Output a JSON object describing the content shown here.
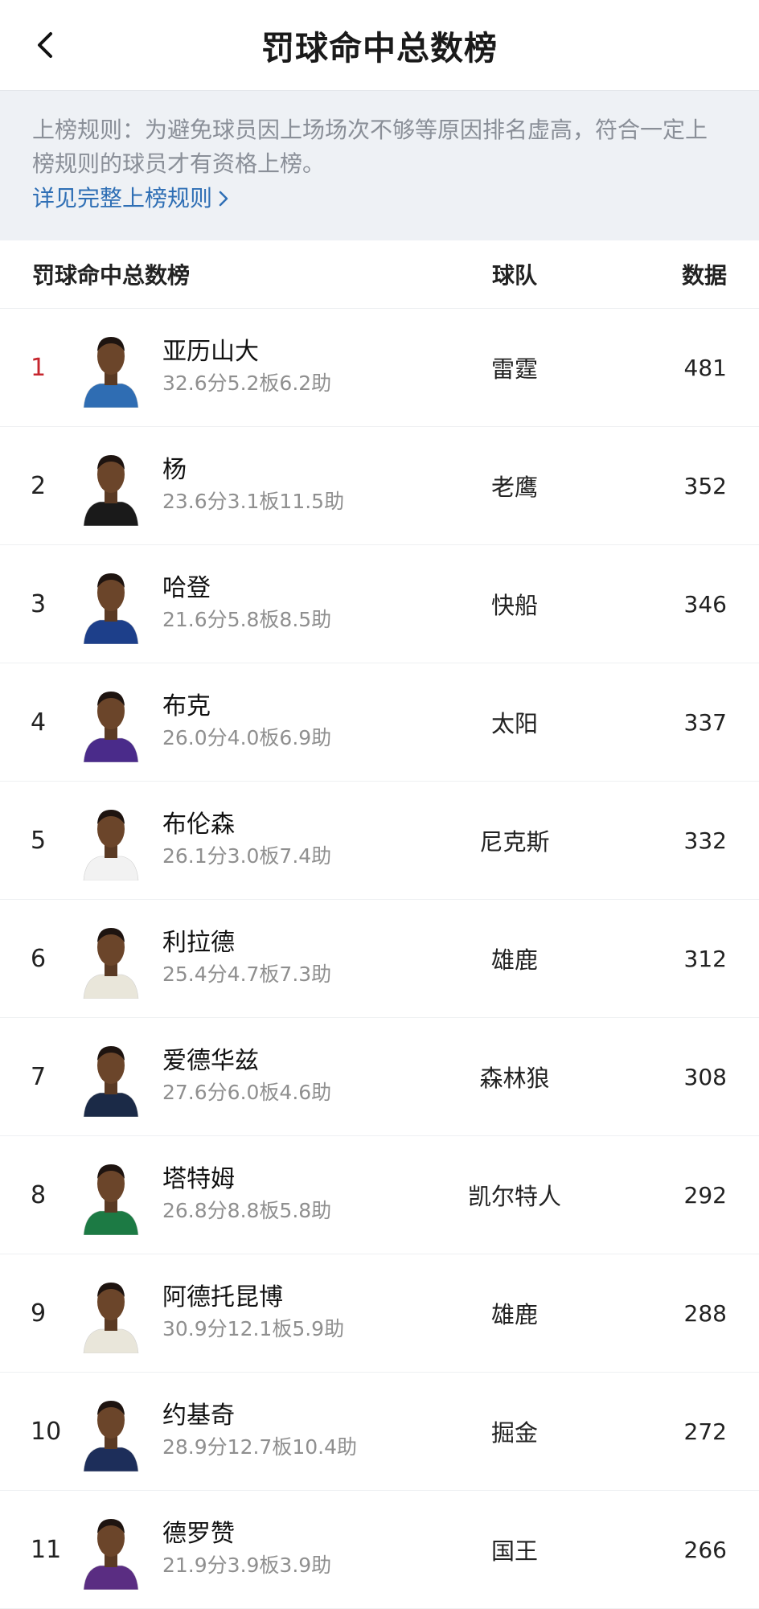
{
  "header": {
    "title": "罚球命中总数榜"
  },
  "notice": {
    "text": "上榜规则：为避免球员因上场场次不够等原因排名虚高，符合一定上榜规则的球员才有资格上榜。",
    "link": "详见完整上榜规则"
  },
  "table": {
    "columns": {
      "name": "罚球命中总数榜",
      "team": "球队",
      "stat": "数据"
    },
    "rows": [
      {
        "rank": "1",
        "name": "亚历山大",
        "line": "32.6分5.2板6.2助",
        "team": "雷霆",
        "value": "481",
        "jersey": "#2f6db3"
      },
      {
        "rank": "2",
        "name": "杨",
        "line": "23.6分3.1板11.5助",
        "team": "老鹰",
        "value": "352",
        "jersey": "#1a1a1a"
      },
      {
        "rank": "3",
        "name": "哈登",
        "line": "21.6分5.8板8.5助",
        "team": "快船",
        "value": "346",
        "jersey": "#1d3f8a"
      },
      {
        "rank": "4",
        "name": "布克",
        "line": "26.0分4.0板6.9助",
        "team": "太阳",
        "value": "337",
        "jersey": "#4a2b8a"
      },
      {
        "rank": "5",
        "name": "布伦森",
        "line": "26.1分3.0板7.4助",
        "team": "尼克斯",
        "value": "332",
        "jersey": "#f2f2f2"
      },
      {
        "rank": "6",
        "name": "利拉德",
        "line": "25.4分4.7板7.3助",
        "team": "雄鹿",
        "value": "312",
        "jersey": "#e9e6da"
      },
      {
        "rank": "7",
        "name": "爱德华兹",
        "line": "27.6分6.0板4.6助",
        "team": "森林狼",
        "value": "308",
        "jersey": "#1b2a47"
      },
      {
        "rank": "8",
        "name": "塔特姆",
        "line": "26.8分8.8板5.8助",
        "team": "凯尔特人",
        "value": "292",
        "jersey": "#1c7a44"
      },
      {
        "rank": "9",
        "name": "阿德托昆博",
        "line": "30.9分12.1板5.9助",
        "team": "雄鹿",
        "value": "288",
        "jersey": "#e9e6da"
      },
      {
        "rank": "10",
        "name": "约基奇",
        "line": "28.9分12.7板10.4助",
        "team": "掘金",
        "value": "272",
        "jersey": "#1d2e5a"
      },
      {
        "rank": "11",
        "name": "德罗赞",
        "line": "21.9分3.9板3.9助",
        "team": "国王",
        "value": "266",
        "jersey": "#5a2d82"
      }
    ]
  },
  "colors": {
    "top_rank": "#c6262e",
    "link": "#2f6fb5",
    "notice_bg": "#eef1f5"
  },
  "icons": {
    "back": "chevron-left-icon",
    "link_arrow": "chevron-right-icon"
  }
}
